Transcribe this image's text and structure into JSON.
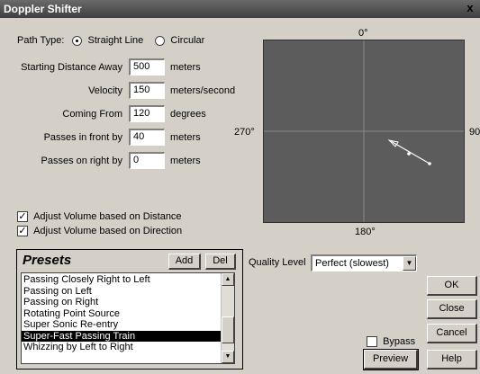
{
  "window": {
    "title": "Doppler Shifter",
    "close_label": "x"
  },
  "path_type": {
    "label": "Path Type:",
    "options": [
      "Straight Line",
      "Circular"
    ],
    "selected": "Straight Line"
  },
  "params": [
    {
      "label": "Starting Distance Away",
      "value": "500",
      "unit": "meters"
    },
    {
      "label": "Velocity",
      "value": "150",
      "unit": "meters/second"
    },
    {
      "label": "Coming From",
      "value": "120",
      "unit": "degrees"
    },
    {
      "label": "Passes in front by",
      "value": "40",
      "unit": "meters"
    },
    {
      "label": "Passes on right by",
      "value": "0",
      "unit": "meters"
    }
  ],
  "checkboxes": [
    {
      "label": "Adjust Volume based on Distance",
      "checked": true
    },
    {
      "label": "Adjust Volume based on Direction",
      "checked": true
    }
  ],
  "plot": {
    "top": "0°",
    "right": "90",
    "bottom": "180°",
    "left": "270°"
  },
  "presets": {
    "title": "Presets",
    "add_label": "Add",
    "del_label": "Del",
    "items": [
      "Passing Closely Right to Left",
      "Passing on Left",
      "Passing on Right",
      "Rotating Point Source",
      "Super Sonic Re-entry",
      "Super-Fast Passing Train",
      "Whizzing by Left to Right"
    ],
    "selected": "Super-Fast Passing Train"
  },
  "quality": {
    "label": "Quality Level",
    "value": "Perfect (slowest)"
  },
  "buttons": {
    "ok": "OK",
    "close": "Close",
    "cancel": "Cancel",
    "preview": "Preview",
    "help": "Help"
  },
  "bypass": {
    "label": "Bypass",
    "checked": false
  }
}
